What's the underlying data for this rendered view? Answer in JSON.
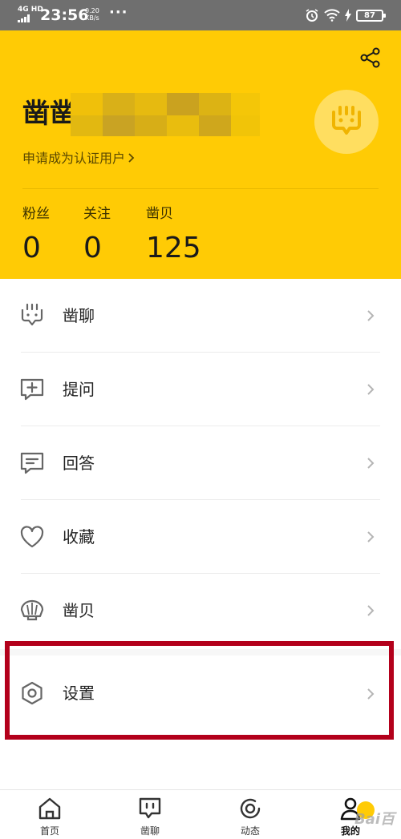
{
  "status_bar": {
    "network": "4G HD",
    "time": "23:56",
    "speed_value": "0.20",
    "speed_unit": "KB/s",
    "more": "···",
    "battery": "87"
  },
  "profile": {
    "username_visible": "凿凿",
    "verify_link": "申请成为认证用户",
    "stats": [
      {
        "label": "粉丝",
        "value": "0"
      },
      {
        "label": "关注",
        "value": "0"
      },
      {
        "label": "凿贝",
        "value": "125"
      }
    ]
  },
  "menu": [
    {
      "label": "凿聊",
      "icon": "chat-grill-icon"
    },
    {
      "label": "提问",
      "icon": "add-question-icon"
    },
    {
      "label": "回答",
      "icon": "answer-icon"
    },
    {
      "label": "收藏",
      "icon": "heart-icon"
    },
    {
      "label": "凿贝",
      "icon": "shell-icon"
    },
    {
      "label": "设置",
      "icon": "gear-icon"
    }
  ],
  "tabs": [
    {
      "label": "首页",
      "icon": "home-icon"
    },
    {
      "label": "凿聊",
      "icon": "chat-icon"
    },
    {
      "label": "动态",
      "icon": "feed-icon"
    },
    {
      "label": "我的",
      "icon": "profile-icon"
    }
  ],
  "watermark": "Bai百",
  "colors": {
    "brand_yellow": "#ffcb05",
    "highlight_red": "#b3001b"
  }
}
